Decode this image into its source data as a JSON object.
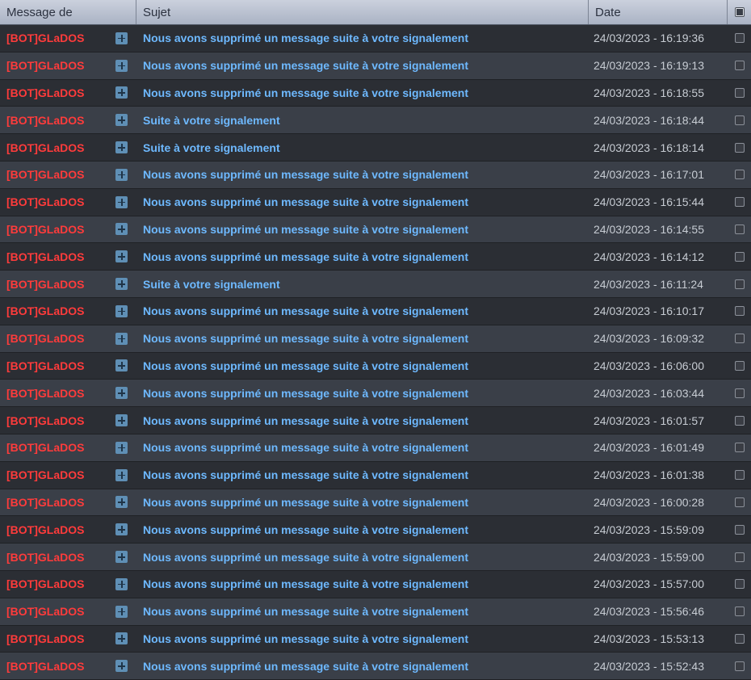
{
  "columns": {
    "from": "Message de",
    "subject": "Sujet",
    "date": "Date"
  },
  "colors": {
    "author": "#ff3b3b",
    "subject_link": "#6eb9ff",
    "header_bg": "#b9c1cf"
  },
  "expand_icon": "plus-square-icon",
  "rows": [
    {
      "from": "[BOT]GLaDOS",
      "subject": "Nous avons supprimé un message suite à votre signalement",
      "date": "24/03/2023 - 16:19:36"
    },
    {
      "from": "[BOT]GLaDOS",
      "subject": "Nous avons supprimé un message suite à votre signalement",
      "date": "24/03/2023 - 16:19:13"
    },
    {
      "from": "[BOT]GLaDOS",
      "subject": "Nous avons supprimé un message suite à votre signalement",
      "date": "24/03/2023 - 16:18:55"
    },
    {
      "from": "[BOT]GLaDOS",
      "subject": "Suite à votre signalement",
      "date": "24/03/2023 - 16:18:44"
    },
    {
      "from": "[BOT]GLaDOS",
      "subject": "Suite à votre signalement",
      "date": "24/03/2023 - 16:18:14"
    },
    {
      "from": "[BOT]GLaDOS",
      "subject": "Nous avons supprimé un message suite à votre signalement",
      "date": "24/03/2023 - 16:17:01"
    },
    {
      "from": "[BOT]GLaDOS",
      "subject": "Nous avons supprimé un message suite à votre signalement",
      "date": "24/03/2023 - 16:15:44"
    },
    {
      "from": "[BOT]GLaDOS",
      "subject": "Nous avons supprimé un message suite à votre signalement",
      "date": "24/03/2023 - 16:14:55"
    },
    {
      "from": "[BOT]GLaDOS",
      "subject": "Nous avons supprimé un message suite à votre signalement",
      "date": "24/03/2023 - 16:14:12"
    },
    {
      "from": "[BOT]GLaDOS",
      "subject": "Suite à votre signalement",
      "date": "24/03/2023 - 16:11:24"
    },
    {
      "from": "[BOT]GLaDOS",
      "subject": "Nous avons supprimé un message suite à votre signalement",
      "date": "24/03/2023 - 16:10:17"
    },
    {
      "from": "[BOT]GLaDOS",
      "subject": "Nous avons supprimé un message suite à votre signalement",
      "date": "24/03/2023 - 16:09:32"
    },
    {
      "from": "[BOT]GLaDOS",
      "subject": "Nous avons supprimé un message suite à votre signalement",
      "date": "24/03/2023 - 16:06:00"
    },
    {
      "from": "[BOT]GLaDOS",
      "subject": "Nous avons supprimé un message suite à votre signalement",
      "date": "24/03/2023 - 16:03:44"
    },
    {
      "from": "[BOT]GLaDOS",
      "subject": "Nous avons supprimé un message suite à votre signalement",
      "date": "24/03/2023 - 16:01:57"
    },
    {
      "from": "[BOT]GLaDOS",
      "subject": "Nous avons supprimé un message suite à votre signalement",
      "date": "24/03/2023 - 16:01:49"
    },
    {
      "from": "[BOT]GLaDOS",
      "subject": "Nous avons supprimé un message suite à votre signalement",
      "date": "24/03/2023 - 16:01:38"
    },
    {
      "from": "[BOT]GLaDOS",
      "subject": "Nous avons supprimé un message suite à votre signalement",
      "date": "24/03/2023 - 16:00:28"
    },
    {
      "from": "[BOT]GLaDOS",
      "subject": "Nous avons supprimé un message suite à votre signalement",
      "date": "24/03/2023 - 15:59:09"
    },
    {
      "from": "[BOT]GLaDOS",
      "subject": "Nous avons supprimé un message suite à votre signalement",
      "date": "24/03/2023 - 15:59:00"
    },
    {
      "from": "[BOT]GLaDOS",
      "subject": "Nous avons supprimé un message suite à votre signalement",
      "date": "24/03/2023 - 15:57:00"
    },
    {
      "from": "[BOT]GLaDOS",
      "subject": "Nous avons supprimé un message suite à votre signalement",
      "date": "24/03/2023 - 15:56:46"
    },
    {
      "from": "[BOT]GLaDOS",
      "subject": "Nous avons supprimé un message suite à votre signalement",
      "date": "24/03/2023 - 15:53:13"
    },
    {
      "from": "[BOT]GLaDOS",
      "subject": "Nous avons supprimé un message suite à votre signalement",
      "date": "24/03/2023 - 15:52:43"
    }
  ]
}
